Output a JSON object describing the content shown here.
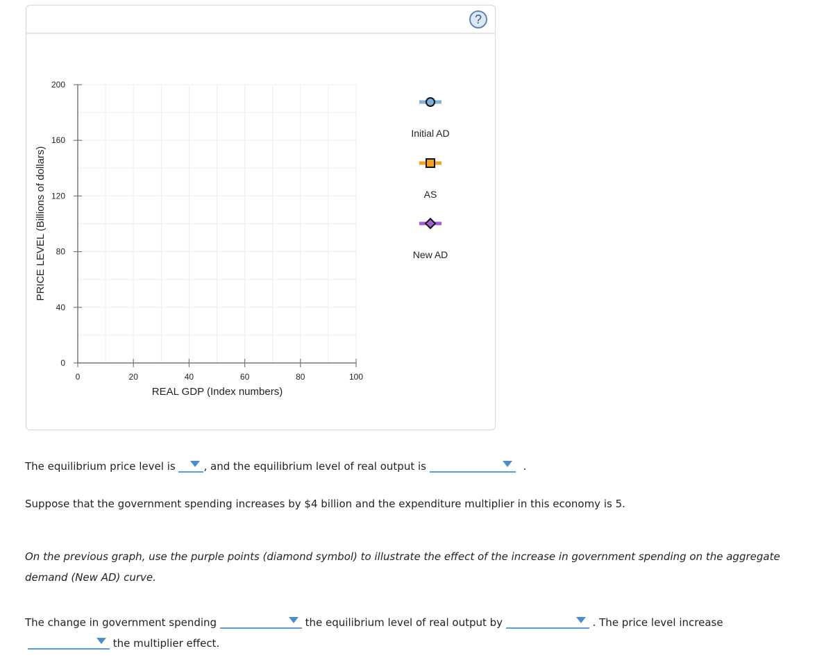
{
  "panel": {
    "help_icon": "?"
  },
  "chart_data": {
    "type": "scatter",
    "title": "",
    "xlabel": "REAL GDP (Index numbers)",
    "ylabel": "PRICE LEVEL (Billions of dollars)",
    "xlim": [
      0,
      100
    ],
    "ylim": [
      0,
      200
    ],
    "xticks": [
      0,
      20,
      40,
      60,
      80,
      100
    ],
    "yticks": [
      0,
      40,
      80,
      120,
      160,
      200
    ],
    "x_grid_step": 10,
    "y_grid_step": 20,
    "grid": true,
    "legend_position": "right",
    "series": [
      {
        "name": "Initial AD",
        "marker": "circle",
        "color": "#7eb1d9",
        "points": []
      },
      {
        "name": "AS",
        "marker": "square",
        "color": "#f7a11a",
        "points": []
      },
      {
        "name": "New AD",
        "marker": "diamond",
        "color": "#a25fd4",
        "points": []
      }
    ]
  },
  "questions": {
    "q1": {
      "prefix": "The equilibrium price level is",
      "middle": ", and the equilibrium level of real output is",
      "suffix": "."
    },
    "q2": "Suppose that the government spending increases by $4 billion and the expenditure multiplier in this economy is 5.",
    "q3_line1": "On the previous graph, use the purple points (diamond symbol) to illustrate the effect of the increase in government spending on the aggregate",
    "q3_line2": "demand (New AD) curve.",
    "q4": {
      "part1": "The change in government spending",
      "part2": "the equilibrium level of real output by",
      "part3": ". The price level increase",
      "part4": "the multiplier effect."
    }
  }
}
